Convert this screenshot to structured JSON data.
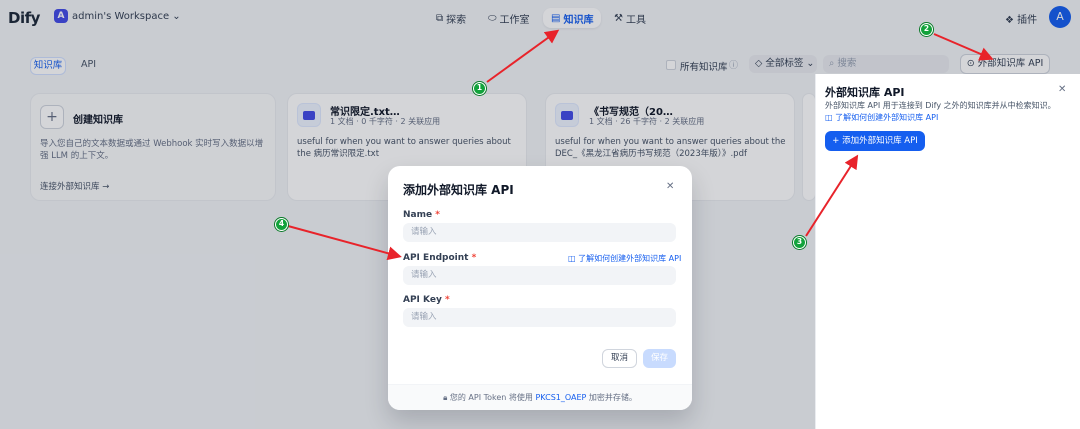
{
  "header": {
    "logo": "Dify",
    "workspace_initial": "A",
    "workspace_name": "admin's Workspace ⌄",
    "nav": [
      {
        "icon": "⧉",
        "label": "探索"
      },
      {
        "icon": "⬭",
        "label": "工作室"
      },
      {
        "icon": "▤",
        "label": "知识库"
      },
      {
        "icon": "⚒",
        "label": "工具"
      }
    ],
    "plugins_label": "插件",
    "user_initial": "A"
  },
  "subbar": {
    "tab_kb": "知识库",
    "tab_api": "API",
    "all_kb_label": "所有知识库",
    "tag_select": "全部标签 ⌄",
    "search_placeholder": "搜索",
    "ext_api_button": "外部知识库 API"
  },
  "cards": {
    "create": {
      "title": "创建知识库",
      "desc": "导入您自己的文本数据或通过 Webhook 实时写入数据以增强 LLM 的上下文。",
      "connect": "连接外部知识库 →"
    },
    "items": [
      {
        "title": "常识限定.txt…",
        "meta": "1 文档 · 0 千字符 · 2 关联应用",
        "desc": "useful for when you want to answer queries about the 病历常识限定.txt"
      },
      {
        "title": "《书写规范（20…",
        "meta": "1 文档 · 26 千字符 · 2 关联应用",
        "desc": "useful for when you want to answer queries about the DEC_《黑龙江省病历书写规范（2023年版）》.pdf"
      }
    ]
  },
  "panel": {
    "title": "外部知识库 API",
    "desc": "外部知识库 API 用于连接到 Dify 之外的知识库并从中检索知识。",
    "link": "了解如何创建外部知识库 API",
    "add_button": "+ 添加外部知识库 API",
    "close": "✕"
  },
  "modal": {
    "title": "添加外部知识库 API",
    "close": "✕",
    "fields": [
      {
        "label": "Name",
        "required": "*",
        "placeholder": "请输入"
      },
      {
        "label": "API Endpoint",
        "required": "*",
        "placeholder": "请输入"
      },
      {
        "label": "API Key",
        "required": "*",
        "placeholder": "请输入"
      }
    ],
    "endpoint_link": "了解如何创建外部知识库 API",
    "cancel": "取消",
    "save": "保存",
    "footer_prefix": "您的 API Token 将使用",
    "footer_highlight": "PKCS1_OAEP",
    "footer_suffix": "加密并存储。"
  },
  "markers": [
    "1",
    "2",
    "3",
    "4"
  ],
  "colors": {
    "accent": "#155eef",
    "marker_green": "#12a33b",
    "arrow_red": "#e8232a"
  }
}
